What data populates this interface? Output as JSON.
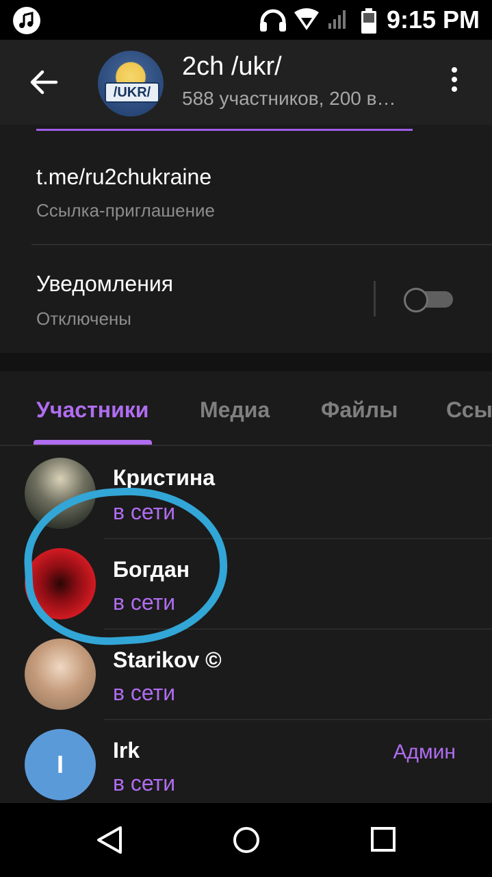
{
  "status_bar": {
    "time": "9:15 PM",
    "icons": [
      "music-icon",
      "headphones-icon",
      "wifi-icon",
      "signal-icon",
      "battery-icon"
    ]
  },
  "header": {
    "avatar_text": "/UKR/",
    "title": "2ch /ukr/",
    "subtitle": "588 участников, 200 в…"
  },
  "info": {
    "link_value": "t.me/ru2chukraine",
    "link_label": "Ссылка-приглашение",
    "notifications_title": "Уведомления",
    "notifications_value": "Отключены",
    "notifications_enabled": false
  },
  "tabs": [
    {
      "label": "Участники",
      "active": true
    },
    {
      "label": "Медиа",
      "active": false
    },
    {
      "label": "Файлы",
      "active": false
    },
    {
      "label": "Ссы",
      "active": false
    }
  ],
  "members": [
    {
      "name": "Кристина",
      "status": "в сети",
      "role": ""
    },
    {
      "name": "Богдан",
      "status": "в сети",
      "role": ""
    },
    {
      "name": "Starikov ©",
      "status": "в сети",
      "role": ""
    },
    {
      "name": "Irk",
      "status": "в сети",
      "role": "Админ",
      "initial": "I"
    }
  ],
  "colors": {
    "accent": "#b06df0",
    "background": "#1b1b1b",
    "appbar": "#212121",
    "highlight_circle": "#32a6d6",
    "avatar_irk": "#5b9ad9"
  }
}
